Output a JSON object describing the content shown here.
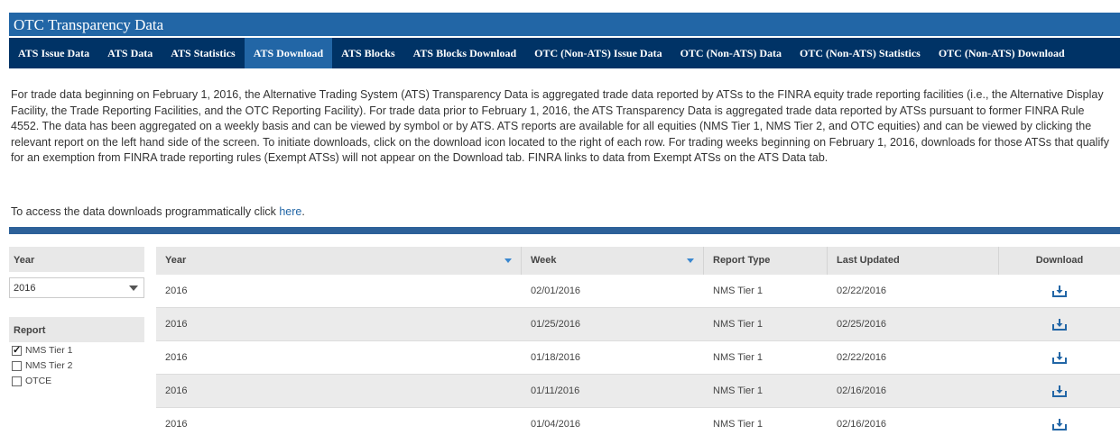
{
  "header": {
    "title": "OTC Transparency Data"
  },
  "nav": {
    "tabs": [
      {
        "label": "ATS Issue Data",
        "active": false
      },
      {
        "label": "ATS Data",
        "active": false
      },
      {
        "label": "ATS Statistics",
        "active": false
      },
      {
        "label": "ATS Download",
        "active": true
      },
      {
        "label": "ATS Blocks",
        "active": false
      },
      {
        "label": "ATS Blocks Download",
        "active": false
      },
      {
        "label": "OTC (Non-ATS) Issue Data",
        "active": false
      },
      {
        "label": "OTC (Non-ATS) Data",
        "active": false
      },
      {
        "label": "OTC (Non-ATS) Statistics",
        "active": false
      },
      {
        "label": "OTC (Non-ATS) Download",
        "active": false
      }
    ]
  },
  "intro": {
    "paragraph": "For trade data beginning on February 1, 2016, the Alternative Trading System (ATS) Transparency Data is aggregated trade data reported by ATSs to the FINRA equity trade reporting facilities (i.e., the Alternative Display Facility, the Trade Reporting Facilities, and the OTC Reporting Facility). For trade data prior to February 1, 2016, the ATS Transparency Data is aggregated trade data reported by ATSs pursuant to former FINRA Rule 4552. The data has been aggregated on a weekly basis and can be viewed by symbol or by ATS. ATS reports are available for all equities (NMS Tier 1, NMS Tier 2, and OTC equities) and can be viewed by clicking the relevant report on the left hand side of the screen. To initiate downloads, click on the download icon located to the right of each row. For trading weeks beginning on February 1, 2016, downloads for those ATSs that qualify for an exemption from FINRA trade reporting rules (Exempt ATSs) will not appear on the Download tab. FINRA links to data from Exempt ATSs on the ATS Data tab.",
    "access_text": "To access the data downloads programmatically click ",
    "access_link": "here",
    "access_end": "."
  },
  "sidebar": {
    "year_header": "Year",
    "year_selected": "2016",
    "report_header": "Report",
    "reports": [
      {
        "label": "NMS Tier 1",
        "checked": true
      },
      {
        "label": "NMS Tier 2",
        "checked": false
      },
      {
        "label": "OTCE",
        "checked": false
      }
    ]
  },
  "table": {
    "columns": [
      "Year",
      "Week",
      "Report Type",
      "Last Updated",
      "Download"
    ],
    "rows": [
      {
        "year": "2016",
        "week": "02/01/2016",
        "report_type": "NMS Tier 1",
        "last_updated": "02/22/2016"
      },
      {
        "year": "2016",
        "week": "01/25/2016",
        "report_type": "NMS Tier 1",
        "last_updated": "02/25/2016"
      },
      {
        "year": "2016",
        "week": "01/18/2016",
        "report_type": "NMS Tier 1",
        "last_updated": "02/22/2016"
      },
      {
        "year": "2016",
        "week": "01/11/2016",
        "report_type": "NMS Tier 1",
        "last_updated": "02/16/2016"
      },
      {
        "year": "2016",
        "week": "01/04/2016",
        "report_type": "NMS Tier 1",
        "last_updated": "02/16/2016"
      }
    ],
    "download_icon": "download-icon"
  },
  "colors": {
    "title_bar": "#2266a6",
    "nav_bg": "#003366",
    "nav_active": "#2266a6",
    "link": "#2266a6",
    "divider": "#2d6199"
  }
}
